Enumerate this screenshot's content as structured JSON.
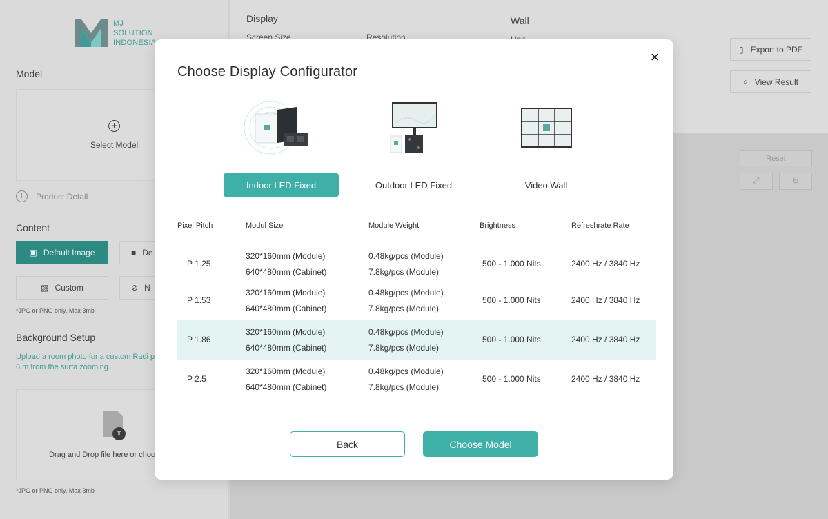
{
  "brand": {
    "line1": "MJ",
    "line2": "SOLUTION",
    "line3": "INDONESIA"
  },
  "sidebar": {
    "model_heading": "Model",
    "select_model": "Select Model",
    "product_detail": "Product Detail",
    "content_heading": "Content",
    "content_buttons": {
      "default_image": "Default Image",
      "default_video_partial": "De",
      "custom": "Custom",
      "none_partial": "N"
    },
    "note": "*JPG or PNG only, Max 3mb",
    "background_heading": "Background Setup",
    "background_desc": "Upload a room photo for a custom Radi preview. Stand about 6 m from the surfa zooming.",
    "drag_drop": "Drag and Drop file here or choo",
    "note2": "*JPG or PNG only, Max 3mb"
  },
  "main": {
    "display_label": "Display",
    "screen_size": "Screen Size",
    "resolution": "Resolution",
    "wall_label": "Wall",
    "unit": "Unit",
    "export_pdf": "Export to PDF",
    "view_result": "View Result",
    "reset": "Reset"
  },
  "modal": {
    "title": "Choose Display Configurator",
    "options": [
      {
        "label": "Indoor LED Fixed",
        "selected": true
      },
      {
        "label": "Outdoor LED Fixed",
        "selected": false
      },
      {
        "label": "Video Wall",
        "selected": false
      }
    ],
    "table": {
      "headers": [
        "Pixel Pitch",
        "Modul Size",
        "Module Weight",
        "Brightness",
        "Refreshrate Rate"
      ],
      "rows": [
        {
          "pitch": "P 1.25",
          "size1": "320*160mm (Module)",
          "size2": "640*480mm (Cabinet)",
          "weight1": "0.48kg/pcs (Module)",
          "weight2": "7.8kg/pcs (Module)",
          "brightness": "500 - 1.000 Nits",
          "refresh": "2400 Hz / 3840 Hz"
        },
        {
          "pitch": "P 1.53",
          "size1": "320*160mm (Module)",
          "size2": "640*480mm (Cabinet)",
          "weight1": "0.48kg/pcs (Module)",
          "weight2": "7.8kg/pcs (Module)",
          "brightness": "500 - 1.000 Nits",
          "refresh": "2400 Hz / 3840 Hz"
        },
        {
          "pitch": "P 1.86",
          "size1": "320*160mm (Module)",
          "size2": "640*480mm (Cabinet)",
          "weight1": "0.48kg/pcs (Module)",
          "weight2": "7.8kg/pcs (Module)",
          "brightness": "500 - 1.000 Nits",
          "refresh": "2400 Hz / 3840 Hz"
        },
        {
          "pitch": "P 2.5",
          "size1": "320*160mm (Module)",
          "size2": "640*480mm (Cabinet)",
          "weight1": "0.48kg/pcs (Module)",
          "weight2": "7.8kg/pcs (Module)",
          "brightness": "500 - 1.000 Nits",
          "refresh": "2400 Hz / 3840 Hz"
        }
      ],
      "highlighted_row": 2
    },
    "back": "Back",
    "choose_model": "Choose  Model"
  },
  "colors": {
    "accent": "#3fb0a8",
    "highlight_row": "#e4f4f2",
    "overlay": "#d3d3d3"
  },
  "icons": [
    "close-icon",
    "plus-circle-icon",
    "info-icon",
    "image-icon",
    "video-icon",
    "custom-image-icon",
    "no-image-icon",
    "file-upload-icon",
    "pdf-icon",
    "view-icon",
    "expand-icon",
    "rotate-icon"
  ]
}
